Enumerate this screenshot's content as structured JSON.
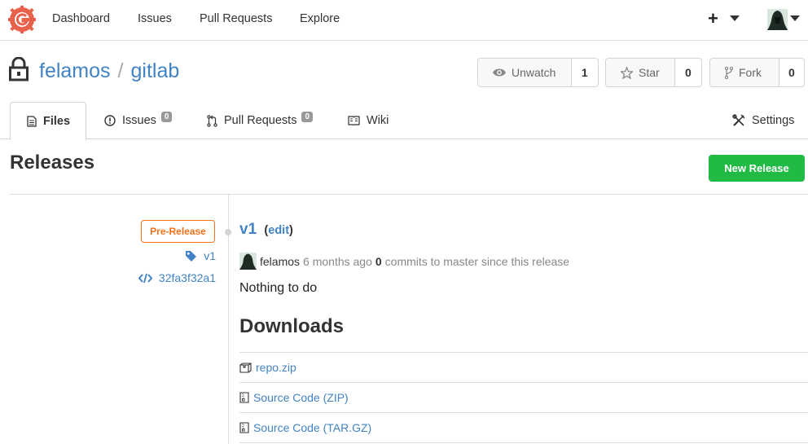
{
  "nav": {
    "items": [
      "Dashboard",
      "Issues",
      "Pull Requests",
      "Explore"
    ],
    "plus_icon": "+"
  },
  "repo": {
    "owner": "felamos",
    "separator": "/",
    "name": "gitlab",
    "watch": {
      "label": "Unwatch",
      "count": "1"
    },
    "star": {
      "label": "Star",
      "count": "0"
    },
    "fork": {
      "label": "Fork",
      "count": "0"
    }
  },
  "tabs": {
    "files": "Files",
    "issues": {
      "label": "Issues",
      "count": "0"
    },
    "pulls": {
      "label": "Pull Requests",
      "count": "0"
    },
    "wiki": "Wiki",
    "settings": "Settings"
  },
  "releases": {
    "title": "Releases",
    "new_button": "New Release",
    "item": {
      "badge": "Pre-Release",
      "tag": "v1",
      "commit": "32fa3f32a1",
      "title": "v1",
      "edit_open": "(",
      "edit_label": "edit",
      "edit_close": ")",
      "author": "felamos",
      "time": "6 months ago",
      "commit_count": "0",
      "commit_text": "commits to master since this release",
      "note": "Nothing to do",
      "downloads_title": "Downloads",
      "downloads": [
        {
          "label": "repo.zip",
          "icon": "package-icon"
        },
        {
          "label": "Source Code (ZIP)",
          "icon": "file-zip-icon"
        },
        {
          "label": "Source Code (TAR.GZ)",
          "icon": "file-zip-icon"
        }
      ]
    }
  },
  "colors": {
    "link": "#4183c4",
    "primary_green": "#21ba45",
    "prerelease_orange": "#f2711c",
    "logo_red": "#e8614a"
  }
}
